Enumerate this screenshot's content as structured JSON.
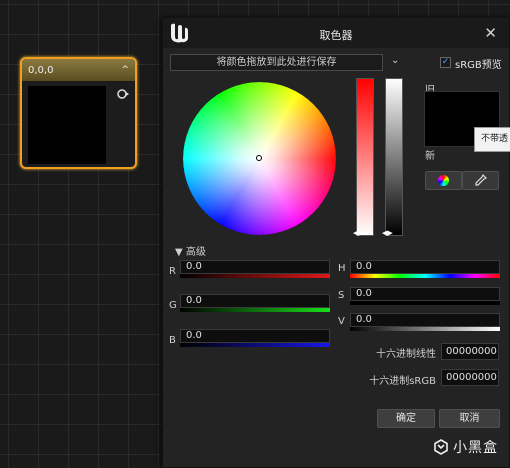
{
  "node": {
    "title": "0,0,0",
    "collapse_glyph": "^",
    "swatch_color": "#000000",
    "border_color": "#f0a020"
  },
  "dialog": {
    "title": "取色器",
    "close_glyph": "✕",
    "theme_bar_text": "将颜色拖放到此处进行保存",
    "theme_dropdown_glyph": "⌄",
    "srgb_checked": true,
    "srgb_label": "sRGB预览",
    "old_label": "旧",
    "new_label": "新",
    "old_color": "#000000",
    "tooltip_text": "不带透",
    "advanced_toggle": "▼ 高级",
    "channels_left": [
      {
        "label": "R",
        "value": "0.0",
        "bar_color": "#c81010"
      },
      {
        "label": "G",
        "value": "0.0",
        "bar_color": "#10c010"
      },
      {
        "label": "B",
        "value": "0.0",
        "bar_color": "#1010d0"
      }
    ],
    "channels_right": [
      {
        "label": "H",
        "value": "0.0"
      },
      {
        "label": "S",
        "value": "0.0"
      },
      {
        "label": "V",
        "value": "0.0"
      }
    ],
    "hex_linear_label": "十六进制线性",
    "hex_linear_value": "00000000",
    "hex_srgb_label": "十六进制sRGB",
    "hex_srgb_value": "00000000",
    "ok_label": "确定",
    "cancel_label": "取消"
  },
  "watermark": {
    "text": "小黑盒"
  }
}
